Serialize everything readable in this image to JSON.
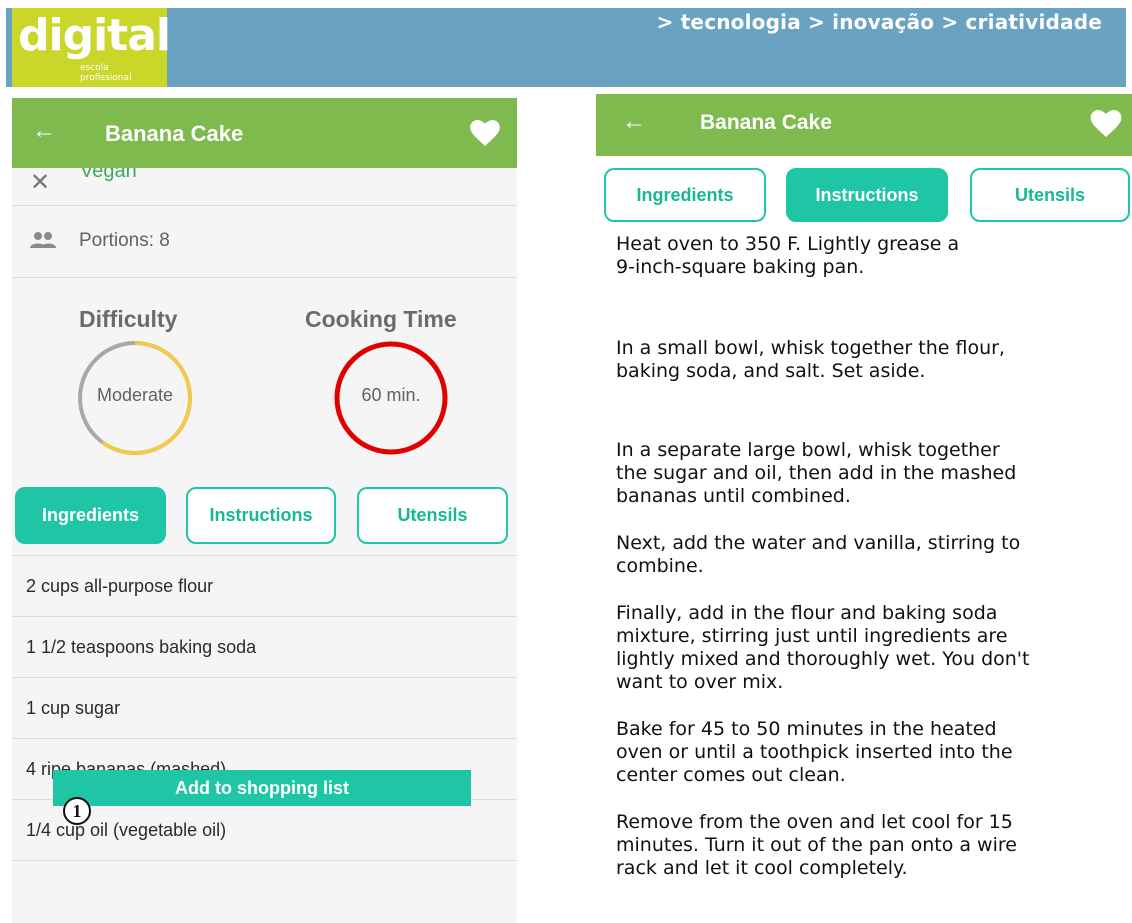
{
  "banner": {
    "logo_main": "digital",
    "logo_sub1": "escola",
    "logo_sub2": "profissional",
    "tagline": "> tecnologia > inovação > criatividade",
    "colors": {
      "bar": "#6aa3c1",
      "logo": "#cbd62b"
    }
  },
  "left_screen": {
    "appbar": {
      "back_icon": "arrow-left-icon",
      "title": "Banana Cake",
      "favorite_icon": "heart-icon"
    },
    "diet": {
      "icon": "close-icon",
      "label": "Vegan"
    },
    "portions": {
      "icon": "people-icon",
      "label": "Portions: 8"
    },
    "difficulty": {
      "title": "Difficulty",
      "value": "Moderate",
      "level": 0.6
    },
    "cooking_time": {
      "title": "Cooking Time",
      "value": "60 min."
    },
    "tabs": [
      {
        "label": "Ingredients",
        "active": true
      },
      {
        "label": "Instructions",
        "active": false
      },
      {
        "label": "Utensils",
        "active": false
      }
    ],
    "ingredients": [
      "2 cups all-purpose flour",
      "1 1/2 teaspoons baking soda",
      "1 cup sugar",
      "4 ripe bananas (mashed)",
      "1/4 cup oil (vegetable oil)"
    ],
    "add_button": "Add to shopping list",
    "callout": "1"
  },
  "right_screen": {
    "appbar": {
      "back_icon": "arrow-left-icon",
      "title": "Banana Cake",
      "favorite_icon": "heart-icon"
    },
    "tabs": [
      {
        "label": "Ingredients",
        "active": false
      },
      {
        "label": "Instructions",
        "active": true
      },
      {
        "label": "Utensils",
        "active": false
      }
    ],
    "instructions": [
      "Heat oven to 350 F. Lightly grease a\n9-inch-square baking pan.",
      "In a small bowl, whisk together the flour,\nbaking soda, and salt. Set aside.",
      "In a separate large bowl, whisk together\nthe sugar and oil, then add in the mashed\nbananas until combined.",
      "Next, add the water and vanilla, stirring to\ncombine.",
      "Finally, add in the flour and baking soda\nmixture, stirring just until ingredients are\nlightly mixed and thoroughly wet. You don't\nwant to over mix.",
      "Bake for 45 to 50 minutes in the heated\noven or until a toothpick inserted into the\ncenter comes out clean.",
      "Remove from the oven and let cool for 15\nminutes. Turn it out of the pan onto a wire\nrack and let it cool completely."
    ]
  },
  "colors": {
    "appbar": "#7fba4e",
    "accent": "#1ec6a6",
    "vegan_text": "#3fa85d",
    "difficulty_ring": "#f2c94c",
    "difficulty_track": "#a8a8a8",
    "time_ring": "#e00000"
  }
}
